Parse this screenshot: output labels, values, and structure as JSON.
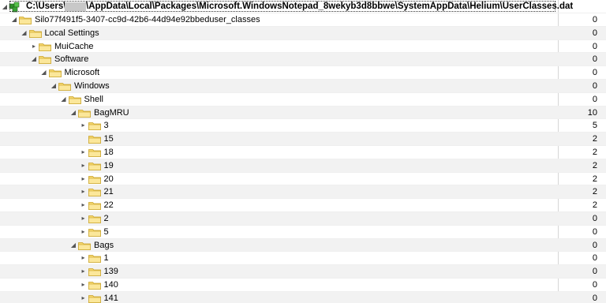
{
  "root": {
    "path_prefix": "C:\\Users\\",
    "path_suffix": "\\AppData\\Local\\Packages\\Microsoft.WindowsNotepad_8wekyb3d8bbwe\\SystemAppData\\Helium\\UserClasses.dat",
    "toggle": "◢",
    "icon": "registry-hive-icon"
  },
  "rows": [
    {
      "label": "Silo77f491f5-3407-cc9d-42b6-44d94e92bbeduser_classes",
      "count": "0",
      "toggle": "◢"
    },
    {
      "label": "Local Settings",
      "count": "0",
      "toggle": "◢"
    },
    {
      "label": "MuiCache",
      "count": "0",
      "toggle": "▸"
    },
    {
      "label": "Software",
      "count": "0",
      "toggle": "◢"
    },
    {
      "label": "Microsoft",
      "count": "0",
      "toggle": "◢"
    },
    {
      "label": "Windows",
      "count": "0",
      "toggle": "◢"
    },
    {
      "label": "Shell",
      "count": "0",
      "toggle": "◢"
    },
    {
      "label": "BagMRU",
      "count": "10",
      "toggle": "◢"
    },
    {
      "label": "3",
      "count": "5",
      "toggle": "▸"
    },
    {
      "label": "15",
      "count": "2",
      "toggle": ""
    },
    {
      "label": "18",
      "count": "2",
      "toggle": "▸"
    },
    {
      "label": "19",
      "count": "2",
      "toggle": "▸"
    },
    {
      "label": "20",
      "count": "2",
      "toggle": "▸"
    },
    {
      "label": "21",
      "count": "2",
      "toggle": "▸"
    },
    {
      "label": "22",
      "count": "2",
      "toggle": "▸"
    },
    {
      "label": "2",
      "count": "0",
      "toggle": "▸"
    },
    {
      "label": "5",
      "count": "0",
      "toggle": "▸"
    },
    {
      "label": "Bags",
      "count": "0",
      "toggle": "◢"
    },
    {
      "label": "1",
      "count": "0",
      "toggle": "▸"
    },
    {
      "label": "139",
      "count": "0",
      "toggle": "▸"
    },
    {
      "label": "140",
      "count": "0",
      "toggle": "▸"
    },
    {
      "label": "141",
      "count": "0",
      "toggle": "▸"
    }
  ],
  "colors": {
    "folder": "#f5d76e",
    "folder_edge": "#c9a227",
    "row_alt": "#f2f2f2",
    "hive_green": "#3aa335"
  }
}
